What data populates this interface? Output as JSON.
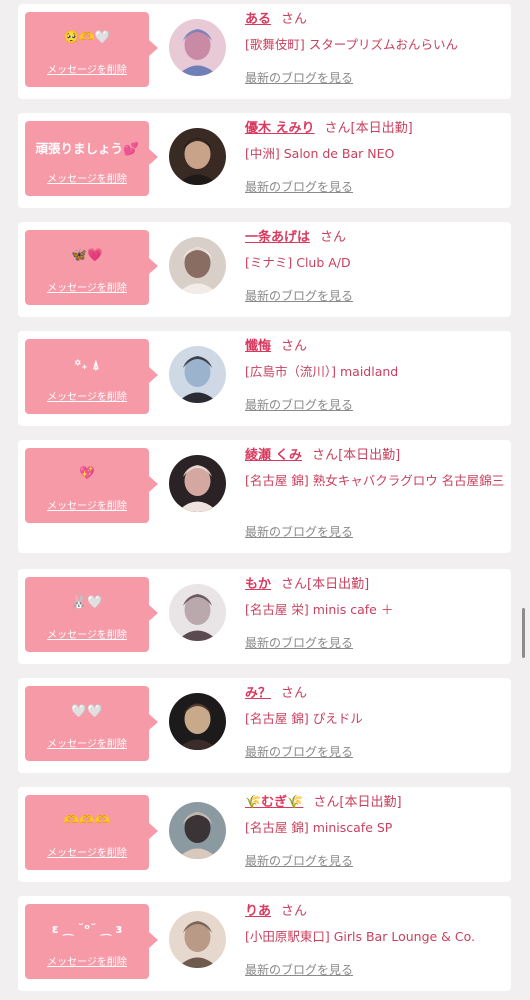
{
  "labels": {
    "delete": "メッセージを削除",
    "blog": "最新のブログを見る",
    "honorific": "さん"
  },
  "colors": {
    "background": "#f1eff0",
    "card": "#ffffff",
    "bubble": "#f79aa8",
    "name": "#d93a5f",
    "text": "#c9415e",
    "link_gray": "#8a8a8a"
  },
  "cards": [
    {
      "message": "🥺🫶🤍",
      "name": "ある",
      "status": "",
      "shop": "[歌舞伎町] スタープリズムおんらいん",
      "avatar": "avatar-photo"
    },
    {
      "message": "頑張りましょう💕",
      "name": "優木 えみり",
      "status": "[本日出勤]",
      "shop": "[中洲] Salon de Bar NEO",
      "avatar": "avatar-photo"
    },
    {
      "message": "🦋💗",
      "name": "一条あげは",
      "status": "",
      "shop": "[ミナミ] Club A/D",
      "avatar": "avatar-photo"
    },
    {
      "message": "꙳₊ ⍋",
      "name": "懺悔",
      "status": "",
      "shop": "[広島市（流川）] maidland",
      "avatar": "avatar-photo"
    },
    {
      "message": "💖",
      "name": "綾瀬 くみ",
      "status": "[本日出勤]",
      "shop": "[名古屋 錦] 熟女キャバクラグロウ 名古屋錦三",
      "avatar": "avatar-photo"
    },
    {
      "message": "🐰🤍",
      "name": "もか",
      "status": "[本日出勤]",
      "shop": "[名古屋 栄] minis cafe ＋",
      "avatar": "avatar-photo"
    },
    {
      "message": "🤍🤍",
      "name": "み？",
      "status": "",
      "shop": "[名古屋 錦] ぴえドル",
      "avatar": "avatar-photo"
    },
    {
      "message": "🫶🫶🫶",
      "name": "🌾むぎ🌾",
      "status": "[本日出勤]",
      "shop": "[名古屋 錦] miniscafe SP",
      "avatar": "avatar-photo"
    },
    {
      "message": "ε ⁔ ˘ᵒ˘ ⁔ ɜ",
      "name": "りあ",
      "status": "",
      "shop": "[小田原駅東口] Girls Bar Lounge & Co.",
      "avatar": "avatar-photo"
    }
  ]
}
